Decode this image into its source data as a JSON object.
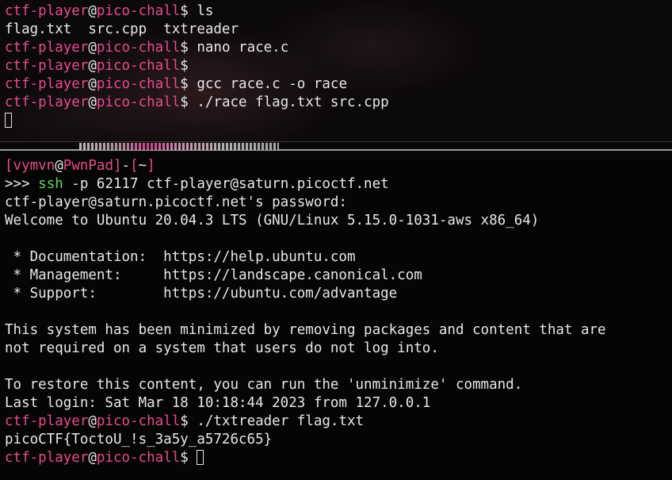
{
  "top_pane": {
    "lines": [
      {
        "type": "prompt",
        "user": "ctf-player",
        "at": "@",
        "host": "pico-chall",
        "sym": "$",
        "cmd": " ls"
      },
      {
        "type": "output",
        "text": "flag.txt  src.cpp  txtreader"
      },
      {
        "type": "prompt",
        "user": "ctf-player",
        "at": "@",
        "host": "pico-chall",
        "sym": "$",
        "cmd": " nano race.c"
      },
      {
        "type": "prompt",
        "user": "ctf-player",
        "at": "@",
        "host": "pico-chall",
        "sym": "$",
        "cmd": ""
      },
      {
        "type": "prompt",
        "user": "ctf-player",
        "at": "@",
        "host": "pico-chall",
        "sym": "$",
        "cmd": " gcc race.c -o race"
      },
      {
        "type": "prompt",
        "user": "ctf-player",
        "at": "@",
        "host": "pico-chall",
        "sym": "$",
        "cmd": " ./race flag.txt src.cpp"
      },
      {
        "type": "cursor"
      }
    ]
  },
  "bottom_pane": {
    "local_prompt": {
      "open": "[",
      "user": "vymvn",
      "at": "@",
      "host": "PwnPad",
      "close": "]",
      "dash": "-",
      "dir_open": "[",
      "dir": "~",
      "dir_close": "]"
    },
    "ssh_line": {
      "arrow": ">>> ",
      "cmd": "ssh",
      "args": " -p 62117 ctf-player@saturn.picoctf.net"
    },
    "output_lines": [
      "ctf-player@saturn.picoctf.net's password:",
      "Welcome to Ubuntu 20.04.3 LTS (GNU/Linux 5.15.0-1031-aws x86_64)",
      "",
      " * Documentation:  https://help.ubuntu.com",
      " * Management:     https://landscape.canonical.com",
      " * Support:        https://ubuntu.com/advantage",
      "",
      "This system has been minimized by removing packages and content that are",
      "not required on a system that users do not log into.",
      "",
      "To restore this content, you can run the 'unminimize' command.",
      "Last login: Sat Mar 18 10:18:44 2023 from 127.0.0.1"
    ],
    "remote_lines": [
      {
        "type": "prompt",
        "user": "ctf-player",
        "at": "@",
        "host": "pico-chall",
        "sym": "$",
        "cmd": " ./txtreader flag.txt"
      },
      {
        "type": "output",
        "text": "picoCTF{ToctoU_!s_3a5y_a5726c65}"
      },
      {
        "type": "prompt-cursor",
        "user": "ctf-player",
        "at": "@",
        "host": "pico-chall",
        "sym": "$",
        "cmd": " "
      }
    ]
  },
  "colors": {
    "prompt_accent": "#e74b8d",
    "ssh_command": "#5fd75f",
    "text": "#e8e8e8",
    "divider_border": "#9a9a9a"
  },
  "icons": {
    "cursor": "block-cursor-icon"
  }
}
